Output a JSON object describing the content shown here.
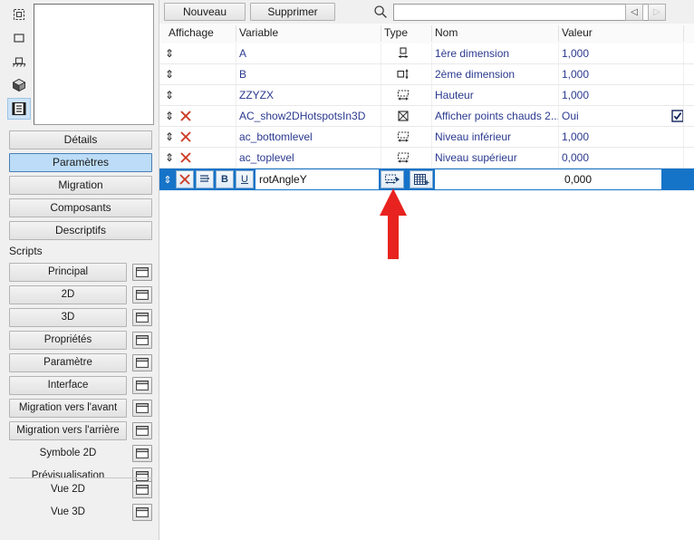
{
  "sidebar": {
    "rail_icons": [
      {
        "name": "selection-tool-icon",
        "glyph": "dashed-square"
      },
      {
        "name": "rectangle-tool-icon",
        "glyph": "square"
      },
      {
        "name": "anchor-tool-icon",
        "glyph": "anchor"
      },
      {
        "name": "cube-3d-icon",
        "glyph": "cube"
      },
      {
        "name": "parameters-list-icon",
        "glyph": "filmstrip",
        "active": true
      }
    ],
    "tabs": [
      {
        "label": "Détails",
        "selected": false
      },
      {
        "label": "Paramètres",
        "selected": true
      },
      {
        "label": "Migration",
        "selected": false
      },
      {
        "label": "Composants",
        "selected": false
      },
      {
        "label": "Descriptifs",
        "selected": false
      }
    ],
    "scripts_label": "Scripts",
    "scripts": [
      {
        "label": "Principal",
        "boxed": true
      },
      {
        "label": "2D",
        "boxed": true
      },
      {
        "label": "3D",
        "boxed": true
      },
      {
        "label": "Propriétés",
        "boxed": true
      },
      {
        "label": "Paramètre",
        "boxed": true
      },
      {
        "label": "Interface",
        "boxed": true
      },
      {
        "label": "Migration vers l'avant",
        "boxed": true
      },
      {
        "label": "Migration vers l'arrière",
        "boxed": true
      },
      {
        "label": "Symbole 2D",
        "boxed": false
      },
      {
        "label": "Prévisualisation",
        "boxed": false
      }
    ],
    "views": [
      {
        "label": "Vue 2D",
        "boxed": false
      },
      {
        "label": "Vue 3D",
        "boxed": false
      }
    ]
  },
  "toolbar": {
    "new_label": "Nouveau",
    "delete_label": "Supprimer",
    "search_value": "",
    "search_placeholder": "",
    "prev_glyph": "◁",
    "next_glyph": "▷"
  },
  "table": {
    "headers": {
      "display": "Affichage",
      "variable": "Variable",
      "type": "Type",
      "name": "Nom",
      "value": "Valeur"
    },
    "rows": [
      {
        "sort": "⇕",
        "locked": false,
        "variable": "A",
        "type_icon": "width-dimension-icon",
        "name": "1ère dimension",
        "value": "1,000",
        "checked": null
      },
      {
        "sort": "⇕",
        "locked": false,
        "variable": "B",
        "type_icon": "depth-dimension-icon",
        "name": "2ème dimension",
        "value": "1,000",
        "checked": null
      },
      {
        "sort": "⇕",
        "locked": false,
        "variable": "ZZYZX",
        "type_icon": "length-icon",
        "name": "Hauteur",
        "value": "1,000",
        "checked": null
      },
      {
        "sort": "⇕",
        "locked": true,
        "variable": "AC_show2DHotspotsIn3D",
        "type_icon": "boolean-icon",
        "name": "Afficher points chauds 2...",
        "value": "Oui",
        "checked": true
      },
      {
        "sort": "⇕",
        "locked": true,
        "variable": "ac_bottomlevel",
        "type_icon": "length-icon",
        "name": "Niveau inférieur",
        "value": "1,000",
        "checked": null
      },
      {
        "sort": "⇕",
        "locked": true,
        "variable": "ac_toplevel",
        "type_icon": "length-icon",
        "name": "Niveau supérieur",
        "value": "0,000",
        "checked": null
      }
    ],
    "edit_row": {
      "sort": "⇕",
      "delete_icon": "delete-x-icon",
      "indent_icon": "indent-arrow-icon",
      "bold_label": "B",
      "underline_label": "U",
      "variable_value": "rotAngleY",
      "type_icon": "length-icon",
      "list_icon": "add-list-icon",
      "name_value": "",
      "value_value": "0,000"
    }
  },
  "annotation": {
    "arrow_name": "red-up-arrow-annotation",
    "arrow_color": "#e8231f"
  },
  "colors": {
    "selection_blue": "#1573c8",
    "link_text": "#2b3a8f",
    "tab_selected": "#bcdcf7",
    "lock_red": "#cc3b23"
  }
}
